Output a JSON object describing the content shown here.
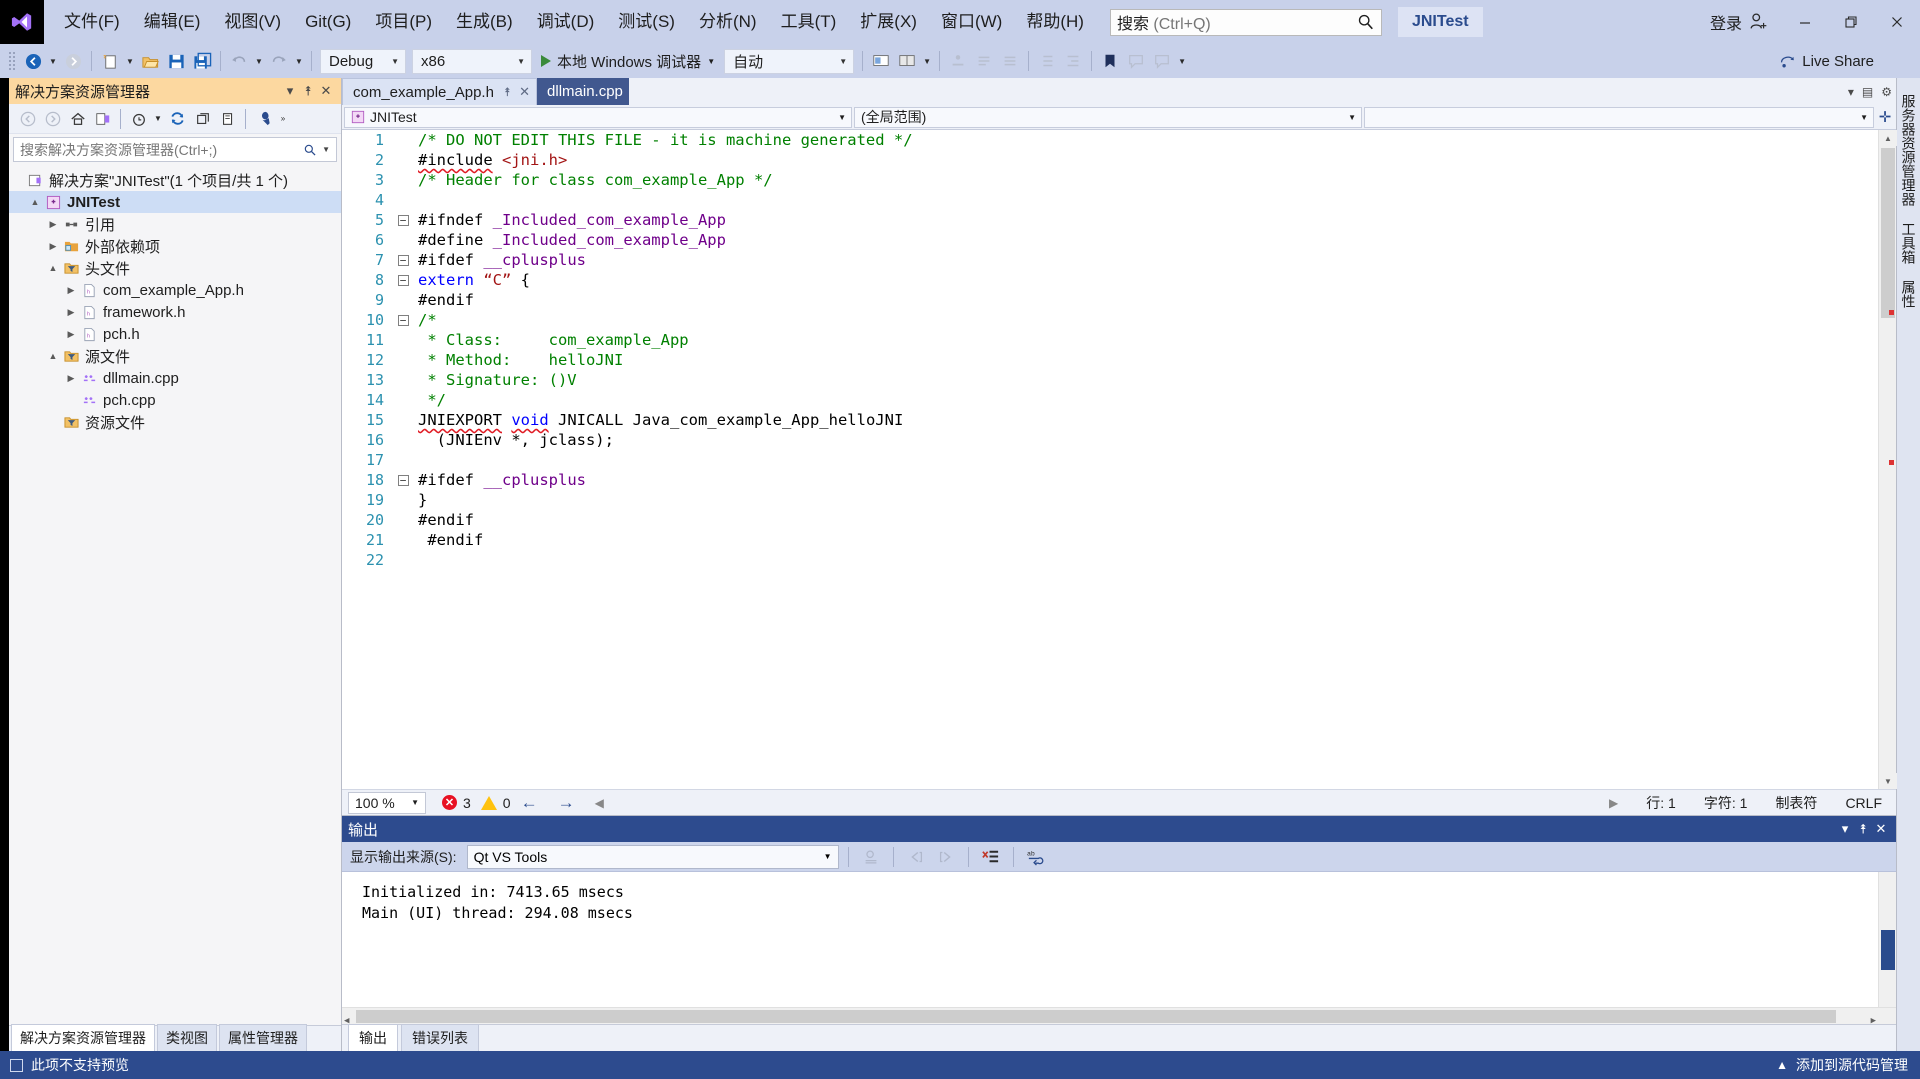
{
  "titlebar": {
    "logo": "vs-logo",
    "menus": [
      {
        "label": "文件(F)"
      },
      {
        "label": "编辑(E)"
      },
      {
        "label": "视图(V)"
      },
      {
        "label": "Git(G)"
      },
      {
        "label": "项目(P)"
      },
      {
        "label": "生成(B)"
      },
      {
        "label": "调试(D)"
      },
      {
        "label": "测试(S)"
      },
      {
        "label": "分析(N)"
      },
      {
        "label": "工具(T)"
      },
      {
        "label": "扩展(X)"
      },
      {
        "label": "窗口(W)"
      },
      {
        "label": "帮助(H)"
      }
    ],
    "search_placeholder_prefix": "搜索",
    "search_placeholder_shortcut": "(Ctrl+Q)",
    "project_chip": "JNITest",
    "signin": "登录",
    "minimize": "—",
    "restore": "❐",
    "close": "✕"
  },
  "toolbar": {
    "back_label": "后退",
    "forward_label": "前进",
    "new_label": "新建项目",
    "open_label": "打开文件",
    "save_label": "保存",
    "saveall_label": "全部保存",
    "undo_label": "撤消",
    "redo_label": "恢复",
    "config": "Debug",
    "platform": "x86",
    "run_label": "本地 Windows 调试器",
    "auto": "自动",
    "live_share": "Live Share"
  },
  "solution_explorer": {
    "title": "解决方案资源管理器",
    "pin_icon": "pin-icon",
    "close_icon": "close-icon",
    "dropdown_icon": "chevron-down-icon",
    "search_placeholder": "搜索解决方案资源管理器(Ctrl+;)",
    "tree": [
      {
        "label": "解决方案\"JNITest\"(1 个项目/共 1 个)",
        "indent": 0,
        "chevron": "",
        "icon": "solution-icon",
        "bold": false,
        "selected": false
      },
      {
        "label": "JNITest",
        "indent": 1,
        "chevron": "▲",
        "icon": "project-icon",
        "bold": true,
        "selected": true
      },
      {
        "label": "引用",
        "indent": 2,
        "chevron": "▶",
        "icon": "references-icon",
        "bold": false,
        "selected": false
      },
      {
        "label": "外部依赖项",
        "indent": 2,
        "chevron": "▶",
        "icon": "folder-ext-icon",
        "bold": false,
        "selected": false
      },
      {
        "label": "头文件",
        "indent": 2,
        "chevron": "▲",
        "icon": "filter-folder-icon",
        "bold": false,
        "selected": false
      },
      {
        "label": "com_example_App.h",
        "indent": 3,
        "chevron": "▶",
        "icon": "header-file-icon",
        "bold": false,
        "selected": false
      },
      {
        "label": "framework.h",
        "indent": 3,
        "chevron": "▶",
        "icon": "header-file-icon",
        "bold": false,
        "selected": false
      },
      {
        "label": "pch.h",
        "indent": 3,
        "chevron": "▶",
        "icon": "header-file-icon",
        "bold": false,
        "selected": false
      },
      {
        "label": "源文件",
        "indent": 2,
        "chevron": "▲",
        "icon": "filter-folder-icon",
        "bold": false,
        "selected": false
      },
      {
        "label": "dllmain.cpp",
        "indent": 3,
        "chevron": "▶",
        "icon": "cpp-file-icon",
        "bold": false,
        "selected": false
      },
      {
        "label": "pch.cpp",
        "indent": 3,
        "chevron": "",
        "icon": "cpp-file-icon",
        "bold": false,
        "selected": false
      },
      {
        "label": "资源文件",
        "indent": 2,
        "chevron": "",
        "icon": "filter-folder-icon",
        "bold": false,
        "selected": false
      }
    ],
    "bottom_tabs": [
      {
        "label": "解决方案资源管理器",
        "active": true
      },
      {
        "label": "类视图",
        "active": false
      },
      {
        "label": "属性管理器",
        "active": false
      }
    ]
  },
  "editor": {
    "tabs": [
      {
        "label": "com_example_App.h",
        "active": true,
        "pinned": true
      },
      {
        "label": "dllmain.cpp",
        "active": false,
        "pinned": false
      }
    ],
    "navbar": {
      "project": "JNITest",
      "scope": "(全局范围)",
      "member": ""
    },
    "code": [
      {
        "n": 1,
        "fold": "",
        "text": "    /* DO NOT EDIT THIS FILE - it is machine generated */"
      },
      {
        "n": 2,
        "fold": "",
        "text": "    #include <jni.h>"
      },
      {
        "n": 3,
        "fold": "",
        "text": "    /* Header for class com_example_App */"
      },
      {
        "n": 4,
        "fold": "",
        "text": ""
      },
      {
        "n": 5,
        "fold": "minus",
        "text": "#ifndef _Included_com_example_App"
      },
      {
        "n": 6,
        "fold": "line",
        "text": " #define _Included_com_example_App"
      },
      {
        "n": 7,
        "fold": "minus",
        "text": "#ifdef __cplusplus"
      },
      {
        "n": 8,
        "fold": "minus",
        "text": "extern “C” {"
      },
      {
        "n": 9,
        "fold": "line",
        "text": " #endif"
      },
      {
        "n": 10,
        "fold": "minus",
        "text": "/*"
      },
      {
        "n": 11,
        "fold": "dash",
        "text": " * Class:     com_example_App"
      },
      {
        "n": 12,
        "fold": "dash",
        "text": " * Method:    helloJNI"
      },
      {
        "n": 13,
        "fold": "dash",
        "text": " * Signature: ()V"
      },
      {
        "n": 14,
        "fold": "dash",
        "text": " */"
      },
      {
        "n": 15,
        "fold": "line",
        "text": "JNIEXPORT void JNICALL Java_com_example_App_helloJNI"
      },
      {
        "n": 16,
        "fold": "dash",
        "text": "   (JNIEnv *, jclass);"
      },
      {
        "n": 17,
        "fold": "dash",
        "text": ""
      },
      {
        "n": 18,
        "fold": "minus",
        "text": "#ifdef __cplusplus"
      },
      {
        "n": 19,
        "fold": "line",
        "text": "}"
      },
      {
        "n": 20,
        "fold": "line",
        "text": " #endif"
      },
      {
        "n": 21,
        "fold": "",
        "text": "  #endif"
      },
      {
        "n": 22,
        "fold": "",
        "text": ""
      }
    ],
    "status": {
      "zoom": "100 %",
      "error_count": "3",
      "warning_count": "0",
      "prev_label": "←",
      "next_label": "→",
      "line": "行: 1",
      "column": "字符: 1",
      "tabs_mode": "制表符",
      "eol": "CRLF"
    }
  },
  "output": {
    "title": "输出",
    "dropdown_icon": "chevron-down-icon",
    "pin_icon": "pin-icon",
    "close_icon": "close-icon",
    "source_label": "显示输出来源(S):",
    "source_value": "Qt VS Tools",
    "toolbar_icons": [
      "find-message-icon",
      "go-previous-icon",
      "go-next-icon",
      "clear-all-icon",
      "word-wrap-icon"
    ],
    "lines": [
      "Initialized in: 7413.65 msecs",
      "Main (UI) thread: 294.08 msecs"
    ],
    "tabs": [
      {
        "label": "输出",
        "active": true
      },
      {
        "label": "错误列表",
        "active": false
      }
    ]
  },
  "right_rail": [
    {
      "label": "服务器资源管理器"
    },
    {
      "label": "工具箱"
    },
    {
      "label": "属性"
    }
  ],
  "footer": {
    "preview_text": "此项不支持预览",
    "add_to_source": "添加到源代码管理",
    "up_icon": "chevron-up-icon",
    "check_icon": "checkbox-icon"
  },
  "colors": {
    "title_bg": "#c8d1ea",
    "accent_blue": "#2d4b8e",
    "solexp_header": "#fcd8a0",
    "tab_inactive": "#41588f",
    "error_red": "#e81123",
    "warning_yellow": "#ffc20e",
    "comment_green": "#008000",
    "macro_purple": "#6f008a",
    "keyword_blue": "#0000ff",
    "string_red": "#a31515",
    "linenum_teal": "#2b91af"
  }
}
